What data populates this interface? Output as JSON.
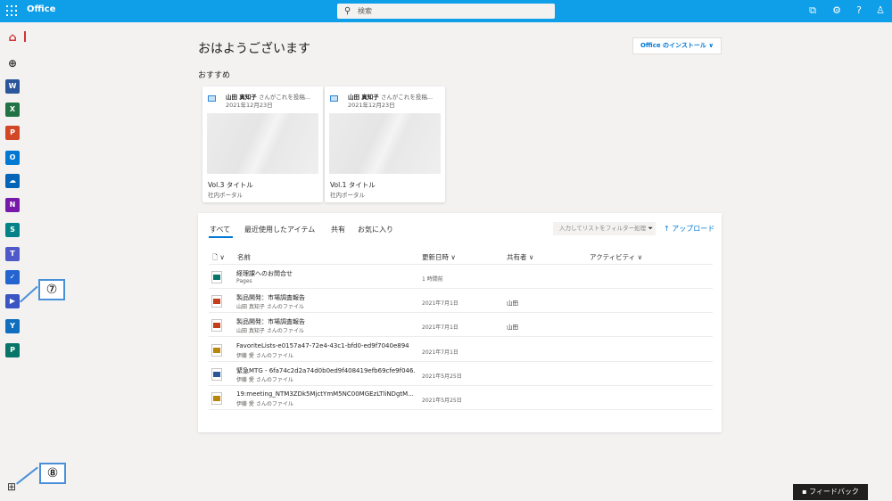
{
  "header": {
    "app_title": "Office",
    "search_placeholder": "検索",
    "icons": [
      "waffle-icon",
      "whiteboard-icon",
      "gear-icon",
      "help-icon",
      "account-icon"
    ]
  },
  "rail": {
    "apps": [
      {
        "name": "home",
        "glyph": "⌂",
        "color": "#d13438"
      },
      {
        "name": "create",
        "glyph": "⊕",
        "color": "#323130"
      },
      {
        "name": "word",
        "glyph": "W",
        "color": "#2b579a"
      },
      {
        "name": "excel",
        "glyph": "X",
        "color": "#217346"
      },
      {
        "name": "powerpoint",
        "glyph": "P",
        "color": "#d24726"
      },
      {
        "name": "outlook",
        "glyph": "O",
        "color": "#0078d4"
      },
      {
        "name": "onedrive",
        "glyph": "☁",
        "color": "#0364b8"
      },
      {
        "name": "onenote",
        "glyph": "N",
        "color": "#7719aa"
      },
      {
        "name": "sharepoint",
        "glyph": "S",
        "color": "#038387"
      },
      {
        "name": "teams",
        "glyph": "T",
        "color": "#5059c9"
      },
      {
        "name": "todo",
        "glyph": "✓",
        "color": "#2564cf"
      },
      {
        "name": "stream",
        "glyph": "▶",
        "color": "#3a54c4"
      },
      {
        "name": "yammer",
        "glyph": "Y",
        "color": "#106ebe"
      },
      {
        "name": "planner",
        "glyph": "P",
        "color": "#077568"
      }
    ],
    "callout_7": "⑦",
    "callout_8": "⑧"
  },
  "main": {
    "greeting": "おはようございます",
    "install_button": "Office のインストール ∨",
    "recommended": "おすすめ",
    "cards": [
      {
        "user": "山田 真知子",
        "action": " さんがこれを投稿...",
        "date": "2021年12月23日",
        "title": "Vol.3 タイトル",
        "site": "社内ポータル"
      },
      {
        "user": "山田 真知子",
        "action": " さんがこれを投稿...",
        "date": "2021年12月23日",
        "title": "Vol.1 タイトル",
        "site": "社内ポータル"
      }
    ],
    "tabs": [
      "すべて",
      "最近使用したアイテム",
      "共有",
      "お気に入り"
    ],
    "filter_placeholder": "入力してリストをフィルター処理",
    "upload": "↑ アップロード",
    "columns": {
      "name": "名前",
      "updated": "更新日時 ∨",
      "shared": "共有者 ∨",
      "activity": "アクティビティ ∨"
    },
    "files": [
      {
        "name": "経理課へのお問合せ",
        "sub": "Pages",
        "updated": "1 時間前",
        "shared": "",
        "color": "#077568"
      },
      {
        "name": "製品開発：市場調査報告",
        "sub": "山田 真知子 さんのファイル",
        "updated": "2021年7月1日",
        "shared": "山田",
        "color": "#c43e1c"
      },
      {
        "name": "製品開発：市場調査報告",
        "sub": "山田 真知子 さんのファイル",
        "updated": "2021年7月1日",
        "shared": "山田",
        "color": "#c43e1c"
      },
      {
        "name": "FavoriteLists-e0157a47-72e4-43c1-bfd0-ed9f7040e894",
        "sub": "伊藤 愛 さんのファイル",
        "updated": "2021年7月1日",
        "shared": "",
        "color": "#b8860b"
      },
      {
        "name": "緊急MTG - 6fa74c2d2a74d0b0ed9f408419efb69cfe9f046...",
        "sub": "伊藤 愛 さんのファイル",
        "updated": "2021年5月25日",
        "shared": "",
        "color": "#2b579a"
      },
      {
        "name": "19:meeting_NTM3ZDk5MjctYmM5NC00MGEzLTliNDgtM...",
        "sub": "伊藤 愛 さんのファイル",
        "updated": "2021年5月25日",
        "shared": "",
        "color": "#b8860b"
      }
    ]
  },
  "feedback": "フィードバック"
}
